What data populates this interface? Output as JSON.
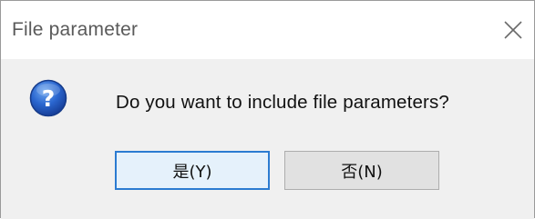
{
  "dialog": {
    "title": "File parameter",
    "message": "Do you want to include file parameters?",
    "icon": "question-icon",
    "buttons": {
      "yes_label": "是(Y)",
      "no_label": "否(N)"
    },
    "close_icon": "close-icon",
    "colors": {
      "accent_border": "#2b7bd1",
      "body_bg": "#f0f0f0",
      "icon_blue": "#1f5fc5"
    }
  }
}
